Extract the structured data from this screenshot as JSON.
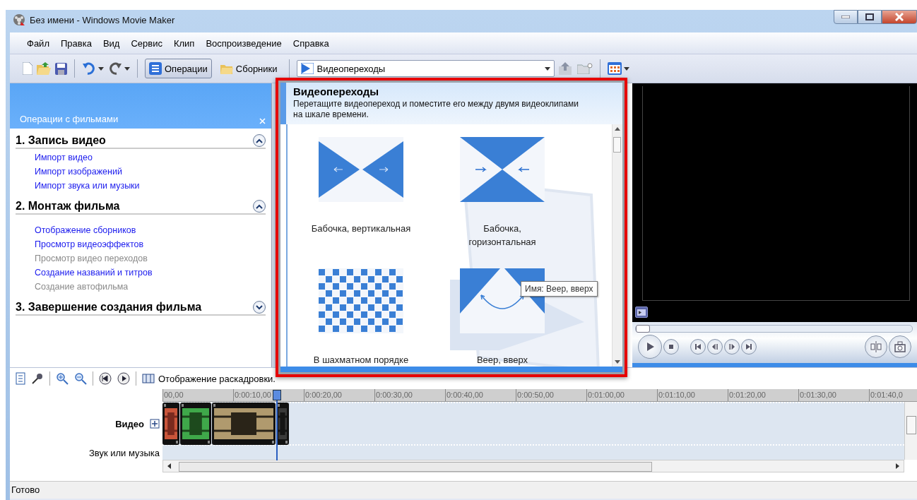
{
  "window": {
    "title": "Без имени - Windows Movie Maker"
  },
  "menu": [
    "Файл",
    "Правка",
    "Вид",
    "Сервис",
    "Клип",
    "Воспроизведение",
    "Справка"
  ],
  "toolbar": {
    "buttons": [
      {
        "label": "Операции",
        "selected": true
      },
      {
        "label": "Сборники",
        "selected": false
      }
    ],
    "collection_dropdown": "Видеопереходы"
  },
  "tasks_pane": {
    "title": "Операции с фильмами",
    "sections": [
      {
        "title": "1. Запись видео",
        "expanded": true,
        "items": [
          {
            "label": "Импорт видео",
            "disabled": false
          },
          {
            "label": "Импорт изображений",
            "disabled": false
          },
          {
            "label": "Импорт звука или музыки",
            "disabled": false
          }
        ]
      },
      {
        "title": "2. Монтаж фильма",
        "expanded": true,
        "items": [
          {
            "label": "Отображение сборников",
            "disabled": false
          },
          {
            "label": "Просмотр видеоэффектов",
            "disabled": false
          },
          {
            "label": "Просмотр видео переходов",
            "disabled": true
          },
          {
            "label": "Создание названий и титров",
            "disabled": false
          },
          {
            "label": "Создание автофильма",
            "disabled": true
          }
        ]
      },
      {
        "title": "3. Завершение создания фильма",
        "expanded": false
      }
    ]
  },
  "collection": {
    "title": "Видеопереходы",
    "description": "Перетащите видеопереход и поместите его между двумя видеоклипами на шкале времени.",
    "transitions": [
      {
        "kind": "bowtie-vertical",
        "label": "Бабочка, вертикальная"
      },
      {
        "kind": "bowtie-horizontal",
        "label": "Бабочка, горизонтальная"
      },
      {
        "kind": "checkerboard",
        "label": "В шахматном порядке"
      },
      {
        "kind": "fan-up",
        "label": "Веер, вверх"
      }
    ],
    "tooltip": "Имя: Веер, вверх"
  },
  "player": {
    "seek": {
      "level": 0
    }
  },
  "timeline": {
    "view_toggle": "Отображение раскадровки.",
    "ruler": [
      "00,00",
      "0:00:10,00",
      "0:00:20,00",
      "0:00:30,00",
      "0:00:40,00",
      "0:00:50,00",
      "0:01:00,00",
      "0:01:10,00",
      "0:01:20,00",
      "0:01:30,00",
      "0:01:40,0"
    ],
    "tracks": [
      {
        "label": "Видео",
        "expanded": false
      },
      {
        "label": "Звук или музыка"
      }
    ]
  },
  "status_bar": "Готово"
}
